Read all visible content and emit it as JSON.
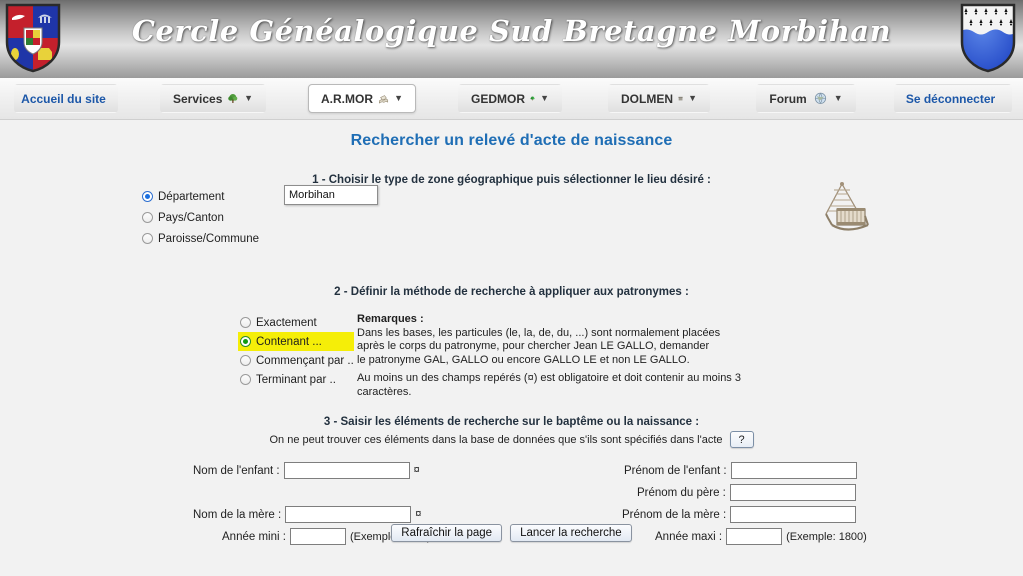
{
  "header": {
    "title": "Cercle Généalogique Sud Bretagne Morbihan",
    "shield_left_name": "coat-of-arms-left",
    "shield_right_name": "coat-of-arms-breton-ermine"
  },
  "nav": {
    "items": [
      {
        "label": "Accueil du site",
        "icon": "home-icon",
        "caret": "",
        "active": false,
        "blue": true
      },
      {
        "label": "Services",
        "icon": "tree-icon",
        "caret": "▼",
        "active": false,
        "blue": false
      },
      {
        "label": "A.R.MOR",
        "icon": "book-icon",
        "caret": "▼",
        "active": true,
        "blue": false
      },
      {
        "label": "GEDMOR",
        "icon": "green-tree-icon",
        "caret": "▼",
        "active": false,
        "blue": false
      },
      {
        "label": "DOLMEN",
        "icon": "dolmen-icon",
        "caret": "▼",
        "active": false,
        "blue": false
      },
      {
        "label": "Forum",
        "icon": "globe-icon",
        "caret": "▼",
        "active": false,
        "blue": false
      },
      {
        "label": "Se déconnecter",
        "icon": "logout-icon",
        "caret": "",
        "active": false,
        "blue": true
      }
    ]
  },
  "page": {
    "title": "Rechercher un relevé d'acte de naissance"
  },
  "step1": {
    "heading_number": "1 - ",
    "heading_text": "Choisir le type de zone géographique puis sélectionner le lieu désiré :",
    "radios": [
      {
        "label": "Département",
        "selected": true
      },
      {
        "label": "Pays/Canton",
        "selected": false
      },
      {
        "label": "Paroisse/Commune",
        "selected": false
      }
    ],
    "place_value": "Morbihan",
    "illustration": "cradle-illustration"
  },
  "step2": {
    "heading_number": "2 - ",
    "heading_text": "Définir la méthode de recherche à appliquer aux patronymes :",
    "radios": [
      {
        "label": "Exactement",
        "selected": false,
        "highlight": false
      },
      {
        "label": "Contenant ...",
        "selected": true,
        "highlight": true
      },
      {
        "label": "Commençant par ..",
        "selected": false,
        "highlight": false
      },
      {
        "label": "Terminant par ..",
        "selected": false,
        "highlight": false
      }
    ],
    "remarks_title": "Remarques :",
    "remarks_line1": "Dans les bases, les particules (le, la, de, du, ...) sont normalement placées",
    "remarks_line2": "après le corps du patronyme, pour chercher Jean LE GALLO, demander",
    "remarks_line3": "le patronyme GAL, GALLO ou encore GALLO LE et non LE GALLO.",
    "remarks_line4": "Au moins un des champs repérés (¤) est obligatoire et doit contenir au moins 3 caractères."
  },
  "step3": {
    "heading_number": "3 - ",
    "heading_text": "Saisir les éléments de recherche sur le baptême ou la naissance :",
    "subtext": "On ne peut trouver ces éléments dans la base de données que s'ils sont spécifiés dans l'acte",
    "help_label": "?",
    "fields": {
      "nom_enfant_label": "Nom de l'enfant :",
      "nom_enfant_value": "",
      "nom_enfant_mark": "¤",
      "nom_mere_label": "Nom de la mère :",
      "nom_mere_value": "",
      "nom_mere_mark": "¤",
      "annee_mini_label": "Année mini :",
      "annee_mini_value": "",
      "annee_mini_hint": "(Exemple: 1750)",
      "prenom_enfant_label": "Prénom de l'enfant :",
      "prenom_enfant_value": "",
      "prenom_pere_label": "Prénom du père :",
      "prenom_pere_value": "",
      "prenom_mere_label": "Prénom de la mère :",
      "prenom_mere_value": "",
      "annee_maxi_label": "Année maxi :",
      "annee_maxi_value": "",
      "annee_maxi_hint": "(Exemple: 1800)"
    }
  },
  "buttons": {
    "refresh_label": "Rafraîchir la page",
    "search_label": "Lancer la recherche"
  },
  "colors": {
    "title_blue": "#1f6eb5",
    "link_blue": "#1c57a8",
    "highlight_yellow": "#f5ee08",
    "radio_green": "#0f9b0f",
    "radio_blue": "#1a6fe0"
  }
}
